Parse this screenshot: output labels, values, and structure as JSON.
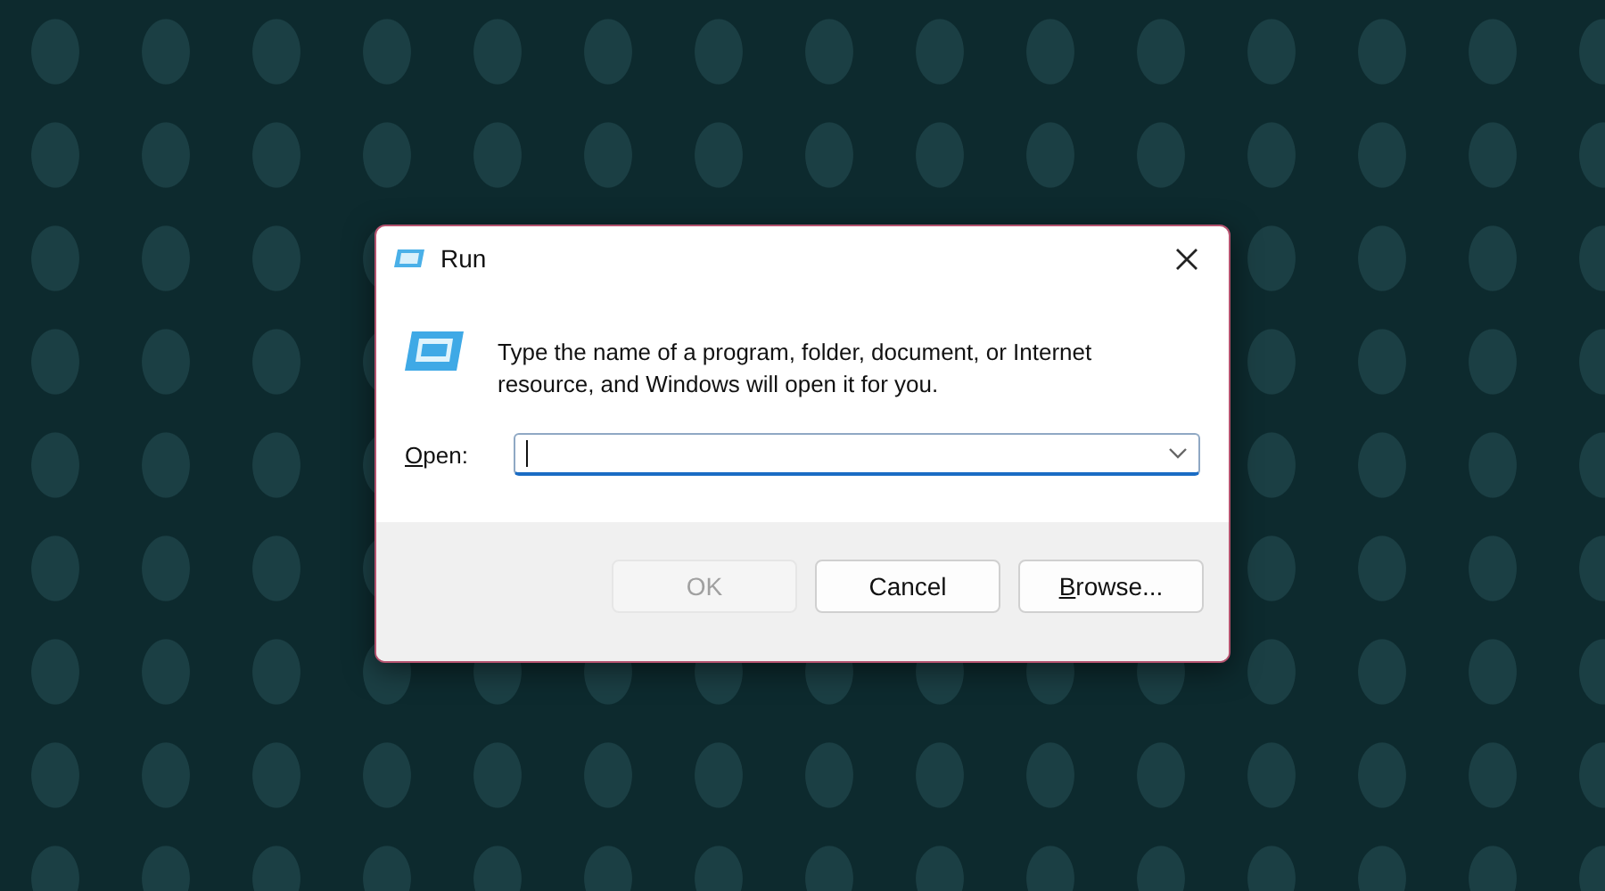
{
  "window": {
    "title": "Run"
  },
  "message": "Type the name of a program, folder, document, or Internet resource, and Windows will open it for you.",
  "open_field": {
    "label": "Open:"
  },
  "buttons": [
    {
      "label": "OK",
      "disabled": true
    },
    {
      "label": "Cancel",
      "disabled": false
    },
    {
      "label": "Browse...",
      "disabled": false
    }
  ]
}
